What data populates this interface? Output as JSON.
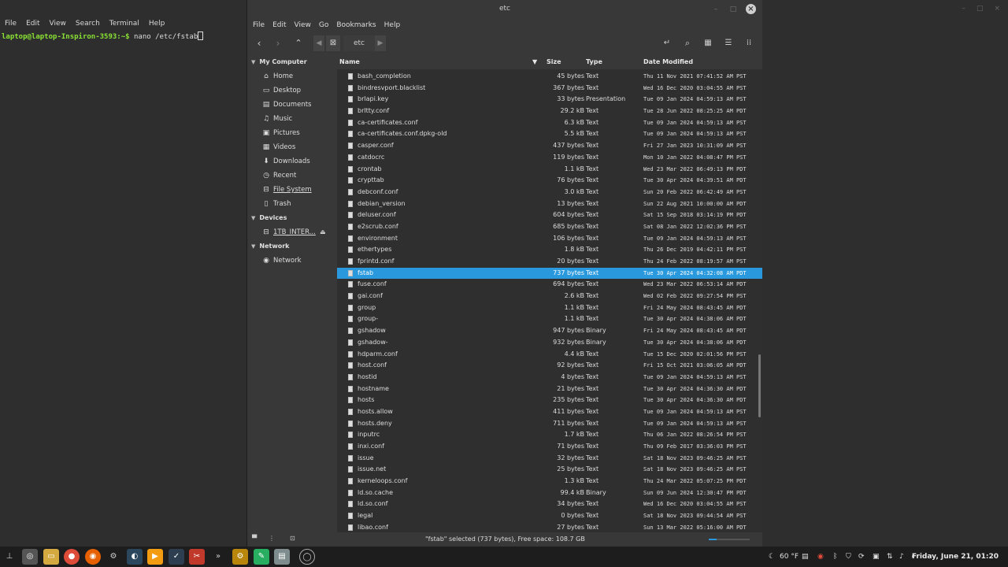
{
  "terminal": {
    "menu": [
      "File",
      "Edit",
      "View",
      "Search",
      "Terminal",
      "Help"
    ],
    "prompt": "laptop@laptop-Inspiron-3593:~$",
    "command": " nano /etc/fstab"
  },
  "filemanager": {
    "title": "etc",
    "menu": [
      "File",
      "Edit",
      "View",
      "Go",
      "Bookmarks",
      "Help"
    ],
    "path_label": "etc",
    "sidebar": {
      "my_computer": "My Computer",
      "items": [
        {
          "label": "Home",
          "icon": "home-icon"
        },
        {
          "label": "Desktop",
          "icon": "desktop-icon"
        },
        {
          "label": "Documents",
          "icon": "documents-icon"
        },
        {
          "label": "Music",
          "icon": "music-icon"
        },
        {
          "label": "Pictures",
          "icon": "pictures-icon"
        },
        {
          "label": "Videos",
          "icon": "videos-icon"
        },
        {
          "label": "Downloads",
          "icon": "downloads-icon"
        },
        {
          "label": "Recent",
          "icon": "recent-icon"
        },
        {
          "label": "File System",
          "icon": "filesystem-icon"
        },
        {
          "label": "Trash",
          "icon": "trash-icon"
        }
      ],
      "devices": "Devices",
      "device_items": [
        {
          "label": "1TB_INTER..."
        }
      ],
      "network": "Network",
      "network_items": [
        {
          "label": "Network"
        }
      ]
    },
    "columns": {
      "name": "Name",
      "size": "Size",
      "type": "Type",
      "date": "Date Modified"
    },
    "files": [
      {
        "name": "bash_completion",
        "size": "45 bytes",
        "type": "Text",
        "date": "Thu 11 Nov 2021 07:41:52 AM PST"
      },
      {
        "name": "bindresvport.blacklist",
        "size": "367 bytes",
        "type": "Text",
        "date": "Wed 16 Dec 2020 03:04:55 AM PST"
      },
      {
        "name": "brlapi.key",
        "size": "33 bytes",
        "type": "Presentation",
        "date": "Tue 09 Jan 2024 04:59:13 AM PST"
      },
      {
        "name": "brltty.conf",
        "size": "29.2 kB",
        "type": "Text",
        "date": "Tue 28 Jun 2022 08:25:25 AM PDT"
      },
      {
        "name": "ca-certificates.conf",
        "size": "6.3 kB",
        "type": "Text",
        "date": "Tue 09 Jan 2024 04:59:13 AM PST"
      },
      {
        "name": "ca-certificates.conf.dpkg-old",
        "size": "5.5 kB",
        "type": "Text",
        "date": "Tue 09 Jan 2024 04:59:13 AM PST"
      },
      {
        "name": "casper.conf",
        "size": "437 bytes",
        "type": "Text",
        "date": "Fri 27 Jan 2023 10:31:09 AM PST"
      },
      {
        "name": "catdocrc",
        "size": "119 bytes",
        "type": "Text",
        "date": "Mon 10 Jan 2022 04:08:47 PM PST"
      },
      {
        "name": "crontab",
        "size": "1.1 kB",
        "type": "Text",
        "date": "Wed 23 Mar 2022 06:49:13 PM PDT"
      },
      {
        "name": "crypttab",
        "size": "76 bytes",
        "type": "Text",
        "date": "Tue 30 Apr 2024 04:39:51 AM PDT"
      },
      {
        "name": "debconf.conf",
        "size": "3.0 kB",
        "type": "Text",
        "date": "Sun 20 Feb 2022 06:42:49 AM PST"
      },
      {
        "name": "debian_version",
        "size": "13 bytes",
        "type": "Text",
        "date": "Sun 22 Aug 2021 10:00:00 AM PDT"
      },
      {
        "name": "deluser.conf",
        "size": "604 bytes",
        "type": "Text",
        "date": "Sat 15 Sep 2018 03:14:19 PM PDT"
      },
      {
        "name": "e2scrub.conf",
        "size": "685 bytes",
        "type": "Text",
        "date": "Sat 08 Jan 2022 12:02:36 PM PST"
      },
      {
        "name": "environment",
        "size": "106 bytes",
        "type": "Text",
        "date": "Tue 09 Jan 2024 04:59:13 AM PST"
      },
      {
        "name": "ethertypes",
        "size": "1.8 kB",
        "type": "Text",
        "date": "Thu 26 Dec 2019 04:42:11 PM PST"
      },
      {
        "name": "fprintd.conf",
        "size": "20 bytes",
        "type": "Text",
        "date": "Thu 24 Feb 2022 08:19:57 AM PST"
      },
      {
        "name": "fstab",
        "size": "737 bytes",
        "type": "Text",
        "date": "Tue 30 Apr 2024 04:32:08 AM PDT",
        "selected": true
      },
      {
        "name": "fuse.conf",
        "size": "694 bytes",
        "type": "Text",
        "date": "Wed 23 Mar 2022 06:53:14 AM PDT"
      },
      {
        "name": "gai.conf",
        "size": "2.6 kB",
        "type": "Text",
        "date": "Wed 02 Feb 2022 09:27:54 PM PST"
      },
      {
        "name": "group",
        "size": "1.1 kB",
        "type": "Text",
        "date": "Fri 24 May 2024 08:43:45 AM PDT"
      },
      {
        "name": "group-",
        "size": "1.1 kB",
        "type": "Text",
        "date": "Tue 30 Apr 2024 04:38:06 AM PDT"
      },
      {
        "name": "gshadow",
        "size": "947 bytes",
        "type": "Binary",
        "date": "Fri 24 May 2024 08:43:45 AM PDT"
      },
      {
        "name": "gshadow-",
        "size": "932 bytes",
        "type": "Binary",
        "date": "Tue 30 Apr 2024 04:38:06 AM PDT"
      },
      {
        "name": "hdparm.conf",
        "size": "4.4 kB",
        "type": "Text",
        "date": "Tue 15 Dec 2020 02:01:56 PM PST"
      },
      {
        "name": "host.conf",
        "size": "92 bytes",
        "type": "Text",
        "date": "Fri 15 Oct 2021 03:06:05 AM PDT"
      },
      {
        "name": "hostid",
        "size": "4 bytes",
        "type": "Text",
        "date": "Tue 09 Jan 2024 04:59:13 AM PST"
      },
      {
        "name": "hostname",
        "size": "21 bytes",
        "type": "Text",
        "date": "Tue 30 Apr 2024 04:36:30 AM PDT"
      },
      {
        "name": "hosts",
        "size": "235 bytes",
        "type": "Text",
        "date": "Tue 30 Apr 2024 04:36:30 AM PDT"
      },
      {
        "name": "hosts.allow",
        "size": "411 bytes",
        "type": "Text",
        "date": "Tue 09 Jan 2024 04:59:13 AM PST"
      },
      {
        "name": "hosts.deny",
        "size": "711 bytes",
        "type": "Text",
        "date": "Tue 09 Jan 2024 04:59:13 AM PST"
      },
      {
        "name": "inputrc",
        "size": "1.7 kB",
        "type": "Text",
        "date": "Thu 06 Jan 2022 08:26:54 PM PST"
      },
      {
        "name": "inxi.conf",
        "size": "71 bytes",
        "type": "Text",
        "date": "Thu 09 Feb 2017 03:36:03 PM PST"
      },
      {
        "name": "issue",
        "size": "32 bytes",
        "type": "Text",
        "date": "Sat 18 Nov 2023 09:46:25 AM PST"
      },
      {
        "name": "issue.net",
        "size": "25 bytes",
        "type": "Text",
        "date": "Sat 18 Nov 2023 09:46:25 AM PST"
      },
      {
        "name": "kerneloops.conf",
        "size": "1.3 kB",
        "type": "Text",
        "date": "Thu 24 Mar 2022 05:07:25 PM PDT"
      },
      {
        "name": "ld.so.cache",
        "size": "99.4 kB",
        "type": "Binary",
        "date": "Sun 09 Jun 2024 12:30:47 PM PDT"
      },
      {
        "name": "ld.so.conf",
        "size": "34 bytes",
        "type": "Text",
        "date": "Wed 16 Dec 2020 03:04:55 AM PST"
      },
      {
        "name": "legal",
        "size": "0 bytes",
        "type": "Text",
        "date": "Sat 18 Nov 2023 09:44:54 AM PST"
      },
      {
        "name": "libao.conf",
        "size": "27 bytes",
        "type": "Text",
        "date": "Sun 13 Mar 2022 05:16:00 AM PDT"
      }
    ],
    "status": "\"fstab\" selected (737 bytes), Free space: 108.7 GB",
    "zoom_fraction": 0.2
  },
  "taskbar": {
    "weather": "60 °F",
    "clock": "Friday, June 21, 01:20"
  },
  "colors": {
    "selection": "#2a98dc",
    "terminal_prompt": "#8ae234"
  }
}
